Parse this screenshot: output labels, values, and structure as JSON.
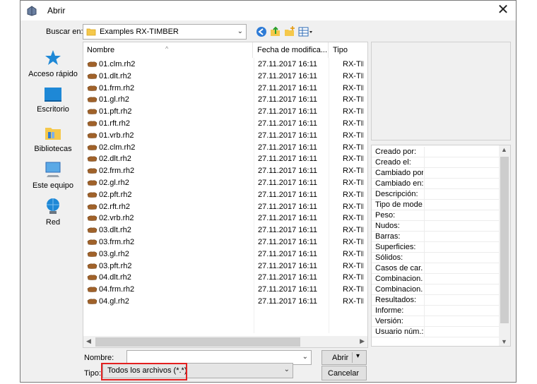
{
  "window": {
    "title": "Abrir",
    "close": "✕"
  },
  "lookin": {
    "label": "Buscar en:",
    "value": "Examples RX-TIMBER"
  },
  "places": [
    {
      "label": "Acceso rápido"
    },
    {
      "label": "Escritorio"
    },
    {
      "label": "Bibliotecas"
    },
    {
      "label": "Este equipo"
    },
    {
      "label": "Red"
    }
  ],
  "columns": {
    "name": "Nombre",
    "date": "Fecha de modifica...",
    "type": "Tipo"
  },
  "files": [
    {
      "name": "01.clm.rh2",
      "date": "27.11.2017 16:11",
      "type": "RX-TIM"
    },
    {
      "name": "01.dlt.rh2",
      "date": "27.11.2017 16:11",
      "type": "RX-TIM"
    },
    {
      "name": "01.frm.rh2",
      "date": "27.11.2017 16:11",
      "type": "RX-TIM"
    },
    {
      "name": "01.gl.rh2",
      "date": "27.11.2017 16:11",
      "type": "RX-TIM"
    },
    {
      "name": "01.pft.rh2",
      "date": "27.11.2017 16:11",
      "type": "RX-TIM"
    },
    {
      "name": "01.rft.rh2",
      "date": "27.11.2017 16:11",
      "type": "RX-TIM"
    },
    {
      "name": "01.vrb.rh2",
      "date": "27.11.2017 16:11",
      "type": "RX-TIM"
    },
    {
      "name": "02.clm.rh2",
      "date": "27.11.2017 16:11",
      "type": "RX-TIM"
    },
    {
      "name": "02.dlt.rh2",
      "date": "27.11.2017 16:11",
      "type": "RX-TIM"
    },
    {
      "name": "02.frm.rh2",
      "date": "27.11.2017 16:11",
      "type": "RX-TIM"
    },
    {
      "name": "02.gl.rh2",
      "date": "27.11.2017 16:11",
      "type": "RX-TIM"
    },
    {
      "name": "02.pft.rh2",
      "date": "27.11.2017 16:11",
      "type": "RX-TIM"
    },
    {
      "name": "02.rft.rh2",
      "date": "27.11.2017 16:11",
      "type": "RX-TIM"
    },
    {
      "name": "02.vrb.rh2",
      "date": "27.11.2017 16:11",
      "type": "RX-TIM"
    },
    {
      "name": "03.dlt.rh2",
      "date": "27.11.2017 16:11",
      "type": "RX-TIM"
    },
    {
      "name": "03.frm.rh2",
      "date": "27.11.2017 16:11",
      "type": "RX-TIM"
    },
    {
      "name": "03.gl.rh2",
      "date": "27.11.2017 16:11",
      "type": "RX-TIM"
    },
    {
      "name": "03.pft.rh2",
      "date": "27.11.2017 16:11",
      "type": "RX-TIM"
    },
    {
      "name": "04.dlt.rh2",
      "date": "27.11.2017 16:11",
      "type": "RX-TIM"
    },
    {
      "name": "04.frm.rh2",
      "date": "27.11.2017 16:11",
      "type": "RX-TIM"
    },
    {
      "name": "04.gl.rh2",
      "date": "27.11.2017 16:11",
      "type": "RX-TIM"
    }
  ],
  "properties": [
    "Creado por:",
    "Creado el:",
    "Cambiado por:",
    "Cambiado en:",
    "Descripción:",
    "Tipo de mode...",
    "Peso:",
    "Nudos:",
    "Barras:",
    "Superficies:",
    "Sólidos:",
    "Casos de car...",
    "Combinacion...",
    "Combinacion...",
    "Resultados:",
    "Informe:",
    "Versión:",
    "Usuario núm.:"
  ],
  "filename": {
    "label": "Nombre:",
    "value": ""
  },
  "filetype": {
    "label": "Tipo:",
    "value": "Todos los archivos (*.*)"
  },
  "buttons": {
    "open": "Abrir",
    "cancel": "Cancelar"
  },
  "colors": {
    "highlight": "#e32020",
    "place_blue": "#1e88d6"
  }
}
